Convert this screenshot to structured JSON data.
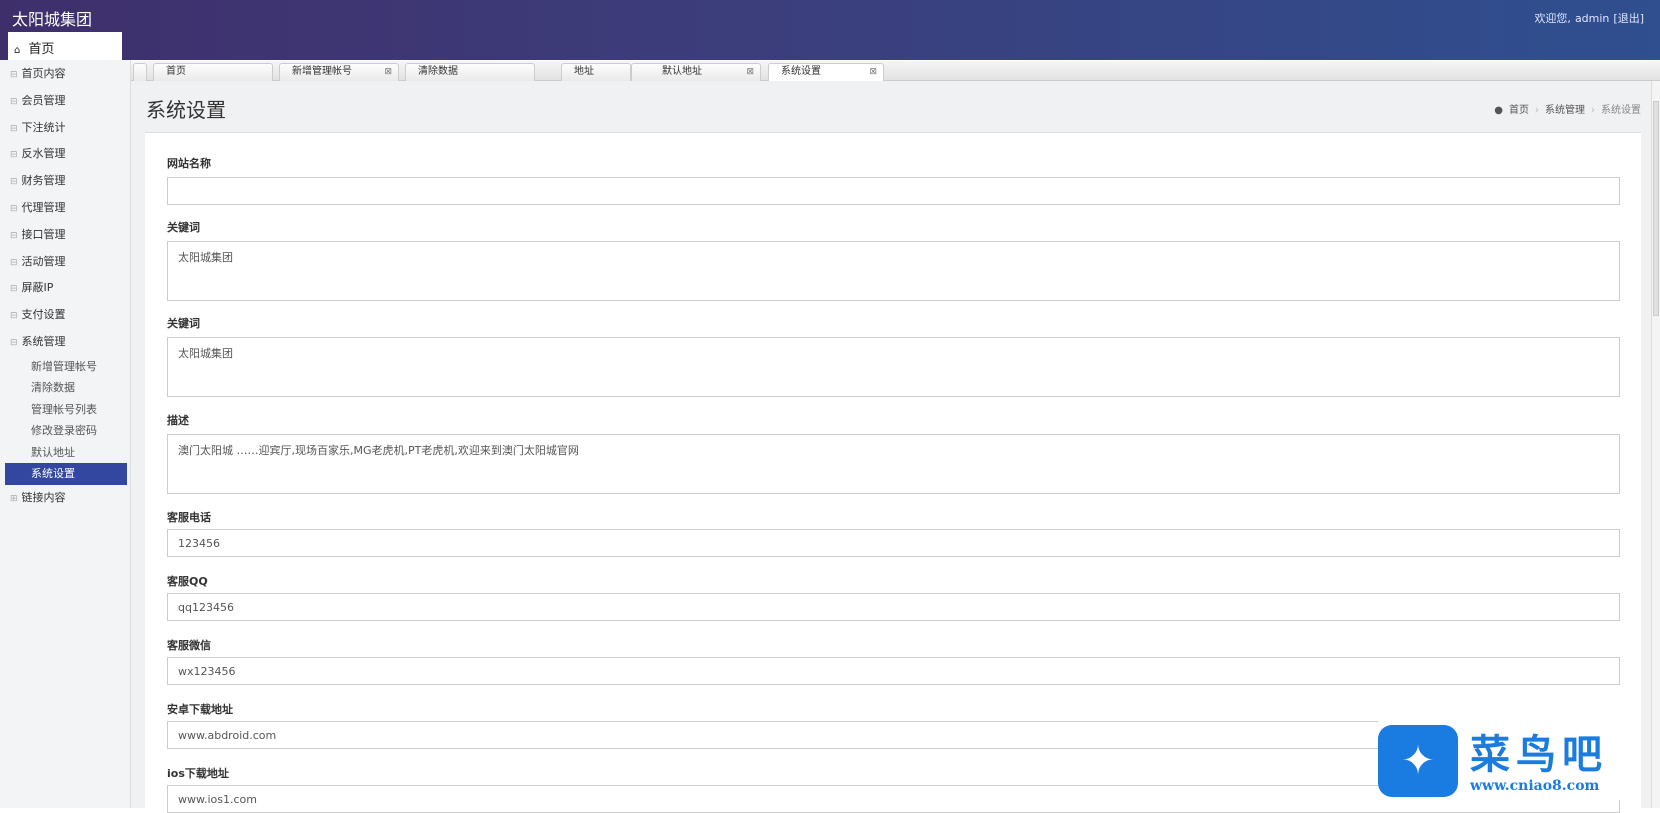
{
  "header": {
    "brand": "太阳城集团",
    "welcome": "欢迎您,",
    "user": "admin",
    "logout": "[退出]",
    "home_tab": "首页"
  },
  "sidebar": {
    "items": [
      {
        "label": "首页内容"
      },
      {
        "label": "会员管理"
      },
      {
        "label": "下注统计"
      },
      {
        "label": "反水管理"
      },
      {
        "label": "财务管理"
      },
      {
        "label": "代理管理"
      },
      {
        "label": "接口管理"
      },
      {
        "label": "活动管理"
      },
      {
        "label": "屏蔽IP"
      },
      {
        "label": "支付设置"
      },
      {
        "label": "系统管理"
      }
    ],
    "subitems": [
      {
        "label": "新增管理帐号"
      },
      {
        "label": "清除数据"
      },
      {
        "label": "管理帐号列表"
      },
      {
        "label": "修改登录密码"
      },
      {
        "label": "默认地址"
      },
      {
        "label": "系统设置"
      }
    ],
    "last": "链接内容"
  },
  "tabs": [
    {
      "label": "首页"
    },
    {
      "label": "新增管理帐号"
    },
    {
      "label": "清除数据"
    },
    {
      "label": "地址"
    },
    {
      "label": "默认地址"
    },
    {
      "label": "系统设置"
    }
  ],
  "page": {
    "title": "系统设置",
    "breadcrumb": [
      "首页",
      "系统管理",
      "系统设置"
    ]
  },
  "form": [
    {
      "label": "网站名称",
      "value": ""
    },
    {
      "label": "关键词",
      "value": "太阳城集团"
    },
    {
      "label": "关键词",
      "value": "太阳城集团"
    },
    {
      "label": "描述",
      "value": "澳门太阳城 ……迎宾厅,现场百家乐,MG老虎机,PT老虎机,欢迎来到澳门太阳城官网"
    },
    {
      "label": "客服电话",
      "value": "123456"
    },
    {
      "label": "客服QQ",
      "value": "qq123456"
    },
    {
      "label": "客服微信",
      "value": "wx123456"
    },
    {
      "label": "安卓下载地址",
      "value": "www.abdroid.com"
    },
    {
      "label": "ios下载地址",
      "value": "www.ios1.com"
    }
  ],
  "watermark": {
    "name": "菜鸟吧",
    "url": "www.cniao8.com"
  }
}
